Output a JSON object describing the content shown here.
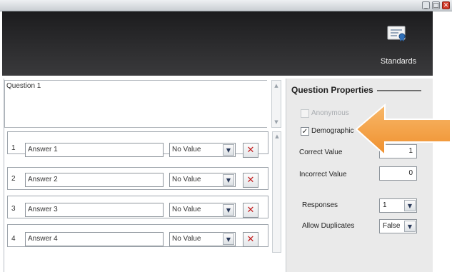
{
  "window": {
    "close": "✕",
    "maximize": "□",
    "minimize": "_"
  },
  "toolbar": {
    "standards_label": "Standards",
    "standards_icon": "certificate-icon"
  },
  "question": {
    "text": "Question 1"
  },
  "answers": [
    {
      "num": "1",
      "text": "Answer 1",
      "value": "No Value"
    },
    {
      "num": "2",
      "text": "Answer 2",
      "value": "No Value"
    },
    {
      "num": "3",
      "text": "Answer 3",
      "value": "No Value"
    },
    {
      "num": "4",
      "text": "Answer 4",
      "value": "No Value"
    }
  ],
  "delete_symbol": "✕",
  "properties": {
    "title": "Question Properties",
    "anonymous_label": "Anonymous",
    "anonymous_checked": false,
    "demographic_label": "Demographic",
    "demographic_checked": true,
    "check_mark": "✓",
    "correct_value_label": "Correct Value",
    "correct_value": "1",
    "incorrect_value_label": "Incorrect Value",
    "incorrect_value": "0",
    "responses_label": "Responses",
    "responses_value": "1",
    "allow_duplicates_label": "Allow Duplicates",
    "allow_duplicates_value": "False"
  },
  "colors": {
    "callout": "#f5a54a",
    "toolbar": "#1c1c1e",
    "panel": "#eaeaea"
  }
}
